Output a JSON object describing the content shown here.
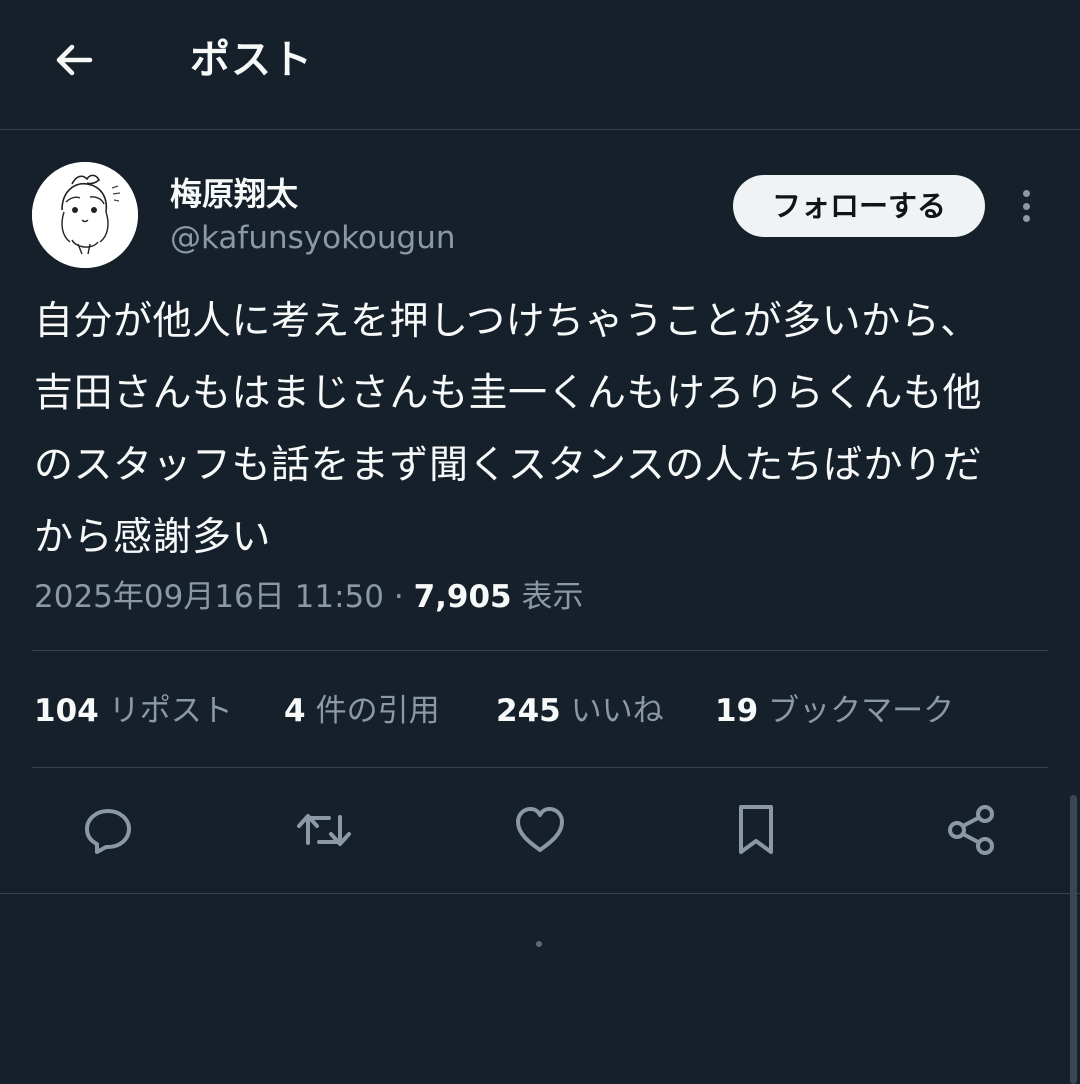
{
  "header": {
    "title": "ポスト",
    "back_icon": "arrow-left-icon"
  },
  "author": {
    "name": "梅原翔太",
    "handle": "@kafunsyokougun",
    "follow_label": "フォローする",
    "more_icon": "more-vertical-icon"
  },
  "post": {
    "text": "自分が他人に考えを押しつけちゃうことが多いから、\n吉田さんもはまじさんも圭一くんもけろりらくんも他\nのスタッフも話をまず聞くスタンスの人たちばかりだ\nから感謝多い",
    "timestamp": "2025年09月16日 11:50",
    "separator": "·",
    "views_count": "7,905",
    "views_label": "表示"
  },
  "stats": {
    "reposts": {
      "count": "104",
      "label": "リポスト"
    },
    "quotes": {
      "count": "4",
      "label": "件の引用"
    },
    "likes": {
      "count": "245",
      "label": "いいね"
    },
    "bookmarks": {
      "count": "19",
      "label": "ブックマーク"
    }
  },
  "actions": [
    "reply-icon",
    "repost-icon",
    "like-icon",
    "bookmark-icon",
    "share-icon"
  ],
  "colors": {
    "background": "#15202b",
    "text": "#f7f9f9",
    "secondary_text": "#8b98a5",
    "divider": "#38444d",
    "follow_button_bg": "#eff3f4"
  }
}
